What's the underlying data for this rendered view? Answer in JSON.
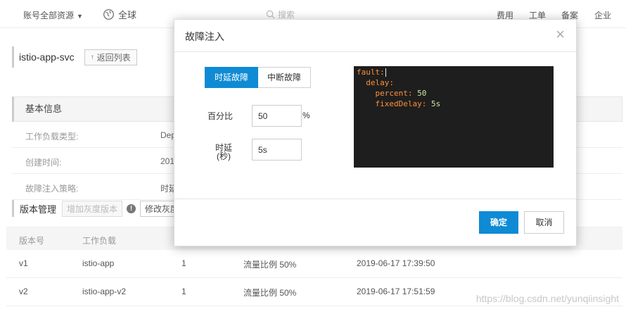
{
  "topbar": {
    "account": "账号全部资源",
    "region": "全球",
    "search_placeholder": "搜索",
    "links": [
      "费用",
      "工单",
      "备案",
      "企业"
    ]
  },
  "service": {
    "name": "istio-app-svc",
    "back_label": "返回列表"
  },
  "basic_info": {
    "title": "基本信息",
    "rows": [
      {
        "label": "工作负载类型:",
        "value": "Dep"
      },
      {
        "label": "创建时间:",
        "value": "201"
      },
      {
        "label": "故障注入策略:",
        "value": "时延"
      }
    ]
  },
  "versions": {
    "title": "版本管理",
    "add_gray_label": "增加灰度版本",
    "edit_gray_label": "修改灰度",
    "columns": [
      "版本号",
      "工作负载"
    ],
    "rows": [
      {
        "version": "v1",
        "workload": "istio-app",
        "count": "1",
        "ratio": "流量比例 50%",
        "time": "2019-06-17 17:39:50"
      },
      {
        "version": "v2",
        "workload": "istio-app-v2",
        "count": "1",
        "ratio": "流量比例 50%",
        "time": "2019-06-17 17:51:59"
      }
    ]
  },
  "modal": {
    "title": "故障注入",
    "close": "×",
    "tabs": [
      {
        "label": "时延故障",
        "active": true
      },
      {
        "label": "中断故障",
        "active": false
      }
    ],
    "percent_label": "百分比",
    "percent_value": "50",
    "percent_unit": "%",
    "delay_label_line1": "时延",
    "delay_label_line2": "(秒)",
    "delay_value": "5s",
    "yaml": {
      "l1_key": "fault:",
      "l2_key": "delay:",
      "l3_key": "percent:",
      "l3_val": "50",
      "l4_key": "fixedDelay:",
      "l4_val": "5s"
    },
    "ok_label": "确定",
    "cancel_label": "取消"
  },
  "watermark": "https://blog.csdn.net/yunqiinsight",
  "colors": {
    "primary": "#0e8bd4",
    "code_bg": "#1e1e1e",
    "code_key": "#ff8f3a",
    "code_value": "#cde8a0"
  }
}
